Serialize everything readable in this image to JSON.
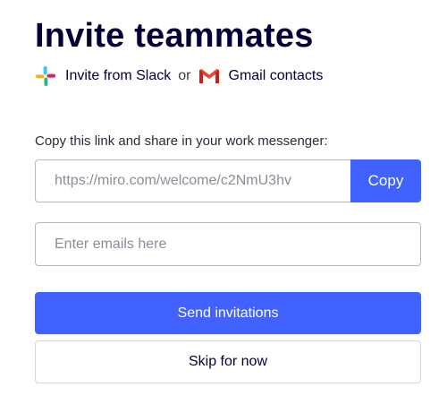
{
  "title": "Invite teammates",
  "sources": {
    "slack": {
      "label": "Invite from Slack",
      "icon": "slack-icon"
    },
    "separator": "or",
    "gmail": {
      "label": "Gmail contacts",
      "icon": "gmail-icon"
    }
  },
  "share": {
    "instruction": "Copy this link and share in your work messenger:",
    "link_value": "https://miro.com/welcome/c2NmU3hv",
    "copy_label": "Copy"
  },
  "emails": {
    "placeholder": "Enter emails here"
  },
  "actions": {
    "send_label": "Send invitations",
    "skip_label": "Skip for now"
  },
  "colors": {
    "accent": "#4262ff",
    "text": "#050038",
    "border": "#b8b8c4",
    "slack_blue": "#36C5F0",
    "slack_green": "#2EB67D",
    "slack_yellow": "#ECB22E",
    "slack_red": "#E01E5A",
    "gmail_red": "#EA4335"
  }
}
